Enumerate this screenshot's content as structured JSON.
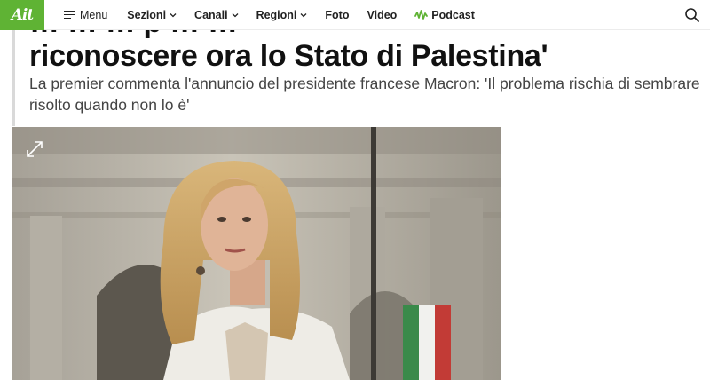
{
  "header": {
    "logo_text": "Ait",
    "menu_label": "Menu",
    "nav": [
      {
        "label": "Sezioni",
        "dropdown": true
      },
      {
        "label": "Canali",
        "dropdown": true
      },
      {
        "label": "Regioni",
        "dropdown": true
      },
      {
        "label": "Foto",
        "dropdown": false
      },
      {
        "label": "Video",
        "dropdown": false
      },
      {
        "label": "Podcast",
        "dropdown": false,
        "icon": "podcast-icon"
      }
    ],
    "search_icon": "search-icon"
  },
  "article": {
    "headline_line1": "… … … p … …",
    "headline_line2": "riconoscere ora lo Stato di Palestina'",
    "summary": "La premier commenta l'annuncio del presidente francese Macron: 'Il problema rischia di sembrare risolto quando non lo è'",
    "photo": {
      "expand_icon": "expand-icon"
    }
  },
  "colors": {
    "brand": "#5fb334",
    "text": "#111111",
    "summary": "#444444"
  }
}
